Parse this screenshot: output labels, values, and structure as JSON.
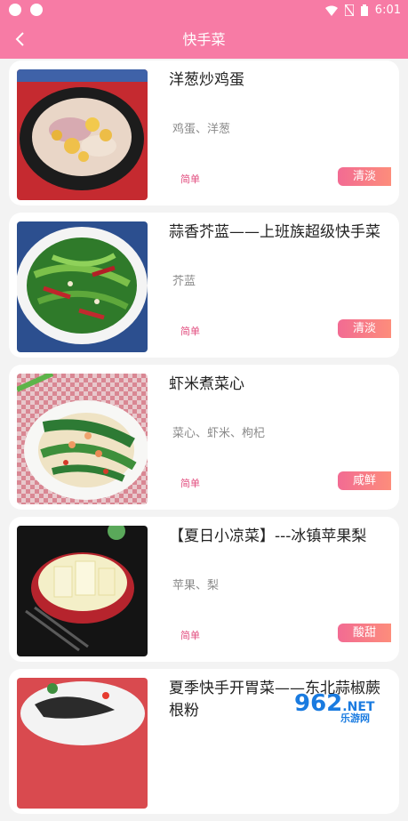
{
  "status_bar": {
    "time": "6:01"
  },
  "header": {
    "title": "快手菜",
    "back_icon": "chevron-left-icon"
  },
  "recipes": [
    {
      "name": "洋葱炒鸡蛋",
      "ingredients": "鸡蛋、洋葱",
      "difficulty": "简单",
      "taste": "清淡"
    },
    {
      "name": "蒜香芥蓝——上班族超级快手菜",
      "ingredients": "芥蓝",
      "difficulty": "简单",
      "taste": "清淡"
    },
    {
      "name": "虾米煮菜心",
      "ingredients": "菜心、虾米、枸杞",
      "difficulty": "简单",
      "taste": "咸鲜"
    },
    {
      "name": "【夏日小凉菜】---冰镇苹果梨",
      "ingredients": "苹果、梨",
      "difficulty": "简单",
      "taste": "酸甜"
    },
    {
      "name": "夏季快手开胃菜——东北蒜椒蕨根粉"
    }
  ],
  "watermark": {
    "logo": "962",
    "suffix": ".NET",
    "site": "乐游网"
  },
  "colors": {
    "accent": "#f77ba5",
    "tag_gradient_start": "#f26b93",
    "tag_gradient_end": "#fd8d7b",
    "difficulty_text": "#e24e7f"
  }
}
